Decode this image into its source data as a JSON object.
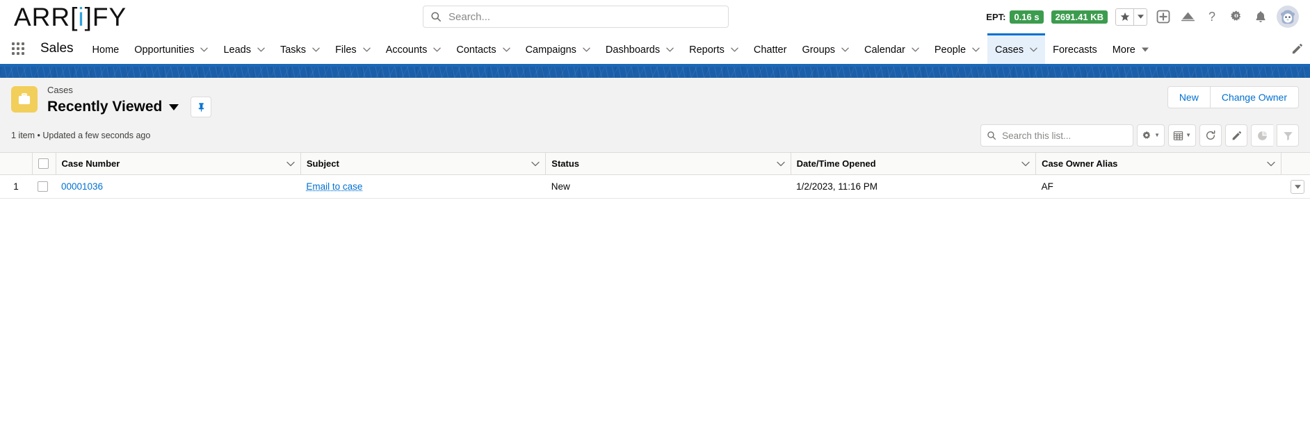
{
  "header": {
    "logo_text_1": "ARR[",
    "logo_accent": "i",
    "logo_text_2": "]FY",
    "search": {
      "placeholder": "Search...",
      "value": ""
    },
    "ept_label": "EPT:",
    "ept_time": "0.16 s",
    "ept_memory": "2691.41 KB",
    "icons": {
      "star": "favorites-star-icon",
      "star_caret": "favorites-dropdown-icon",
      "plus": "global-actions-plus-icon",
      "cloud": "mobile-publisher-icon",
      "help": "help-question-icon",
      "setup": "setup-gear-icon",
      "notifications": "notifications-bell-icon",
      "avatar": "user-avatar"
    }
  },
  "nav": {
    "app_launcher": "app-launcher-grid",
    "app_name": "Sales",
    "items": [
      {
        "label": "Home",
        "has_caret": false,
        "active": false
      },
      {
        "label": "Opportunities",
        "has_caret": true,
        "active": false
      },
      {
        "label": "Leads",
        "has_caret": true,
        "active": false
      },
      {
        "label": "Tasks",
        "has_caret": true,
        "active": false
      },
      {
        "label": "Files",
        "has_caret": true,
        "active": false
      },
      {
        "label": "Accounts",
        "has_caret": true,
        "active": false
      },
      {
        "label": "Contacts",
        "has_caret": true,
        "active": false
      },
      {
        "label": "Campaigns",
        "has_caret": true,
        "active": false
      },
      {
        "label": "Dashboards",
        "has_caret": true,
        "active": false
      },
      {
        "label": "Reports",
        "has_caret": true,
        "active": false
      },
      {
        "label": "Chatter",
        "has_caret": false,
        "active": false
      },
      {
        "label": "Groups",
        "has_caret": true,
        "active": false
      },
      {
        "label": "Calendar",
        "has_caret": true,
        "active": false
      },
      {
        "label": "People",
        "has_caret": true,
        "active": false
      },
      {
        "label": "Cases",
        "has_caret": true,
        "active": true
      },
      {
        "label": "Forecasts",
        "has_caret": false,
        "active": false
      },
      {
        "label": "More",
        "has_caret": true,
        "active": false
      }
    ],
    "edit_icon": "edit-navigation-pencil-icon"
  },
  "list_header": {
    "object_icon": "case-briefcase-icon",
    "breadcrumb": "Cases",
    "title": "Recently Viewed",
    "title_caret": "list-view-chevron-down-icon",
    "pin_icon": "pin-list-view-icon",
    "new_button": "New",
    "change_owner_button": "Change Owner",
    "item_count": "1 item • Updated a few seconds ago",
    "list_search_placeholder": "Search this list...",
    "list_search_value": "",
    "tools": {
      "settings": "list-view-controls-gear-icon",
      "display_as": "display-as-table-icon",
      "refresh": "refresh-icon",
      "edit": "edit-pencil-icon",
      "chart": "toggle-chart-pie-icon",
      "filter": "show-filters-funnel-icon"
    }
  },
  "table": {
    "columns": [
      {
        "label": "Case Number",
        "has_caret": true
      },
      {
        "label": "Subject",
        "has_caret": true
      },
      {
        "label": "Status",
        "has_caret": true
      },
      {
        "label": "Date/Time Opened",
        "has_caret": true
      },
      {
        "label": "Case Owner Alias",
        "has_caret": true
      }
    ],
    "rows": [
      {
        "index": "1",
        "case_number": "00001036",
        "subject": "Email to case",
        "status": "New",
        "date_time_opened": "1/2/2023, 11:16 PM",
        "case_owner_alias": "AF"
      }
    ]
  },
  "colors": {
    "accent_blue": "#0070d2",
    "nav_active_bg": "#e5f0fb",
    "banner_blue": "#1b5faa",
    "case_icon_yellow": "#f2cf5b",
    "badge_green": "#3c9c4e",
    "logo_accent": "#2fa3e0"
  }
}
